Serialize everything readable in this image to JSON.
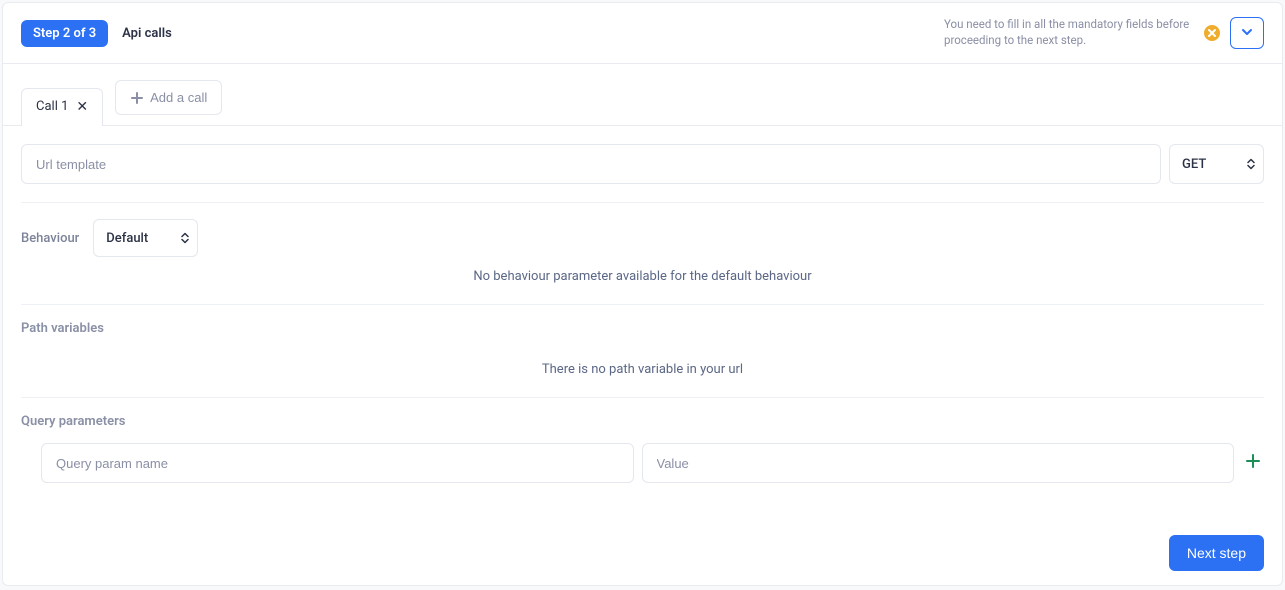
{
  "header": {
    "step_badge": "Step 2 of 3",
    "title": "Api calls",
    "warning": "You need to fill in all the mandatory fields before proceeding to the next step."
  },
  "tabs": {
    "active_label": "Call 1",
    "add_label": "Add a call"
  },
  "url": {
    "placeholder": "Url template",
    "value": "",
    "method": "GET"
  },
  "behaviour": {
    "label": "Behaviour",
    "selected": "Default",
    "empty_msg": "No behaviour parameter available for the default behaviour"
  },
  "path_vars": {
    "title": "Path variables",
    "empty_msg": "There is no path variable in your url"
  },
  "query": {
    "title": "Query parameters",
    "name_placeholder": "Query param name",
    "value_placeholder": "Value"
  },
  "footer": {
    "next_label": "Next step"
  }
}
